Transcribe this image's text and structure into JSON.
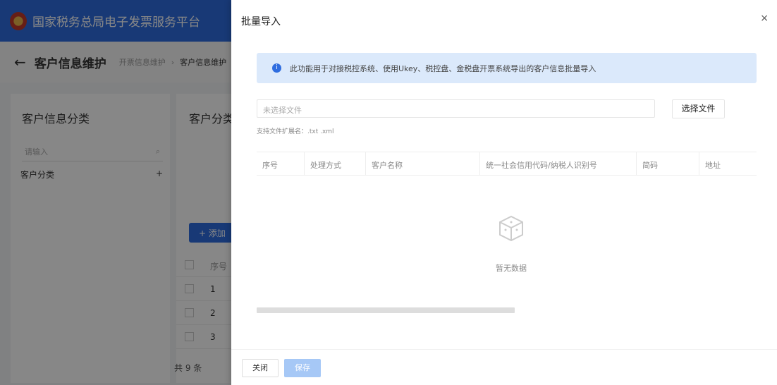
{
  "app": {
    "title": "国家税务总局电子发票服务平台"
  },
  "page": {
    "title": "客户信息维护",
    "breadcrumb": [
      "开票信息维护",
      "客户信息维护"
    ],
    "breadcrumb_sep": "›",
    "back_icon": "←"
  },
  "left_panel": {
    "title": "客户信息分类",
    "search_placeholder": "请输入",
    "tree": [
      {
        "label": "客户分类",
        "action": "+"
      }
    ]
  },
  "right_panel": {
    "title": "客户分类",
    "add_button": "+ 添加",
    "col_index": "序号",
    "rows": [
      "1",
      "2",
      "3"
    ],
    "total": "共 9 条"
  },
  "drawer": {
    "title": "批量导入",
    "close": "×",
    "info": "此功能用于对接税控系统、使用Ukey、税控盘、金税盘开票系统导出的客户信息批量导入",
    "file_placeholder": "未选择文件",
    "select_file": "选择文件",
    "hint": "支持文件扩展名：.txt .xml",
    "columns": [
      "序号",
      "处理方式",
      "客户名称",
      "统一社会信用代码/纳税人识别号",
      "简码",
      "地址"
    ],
    "empty": "暂无数据",
    "footer": {
      "close": "关闭",
      "save": "保存"
    }
  }
}
